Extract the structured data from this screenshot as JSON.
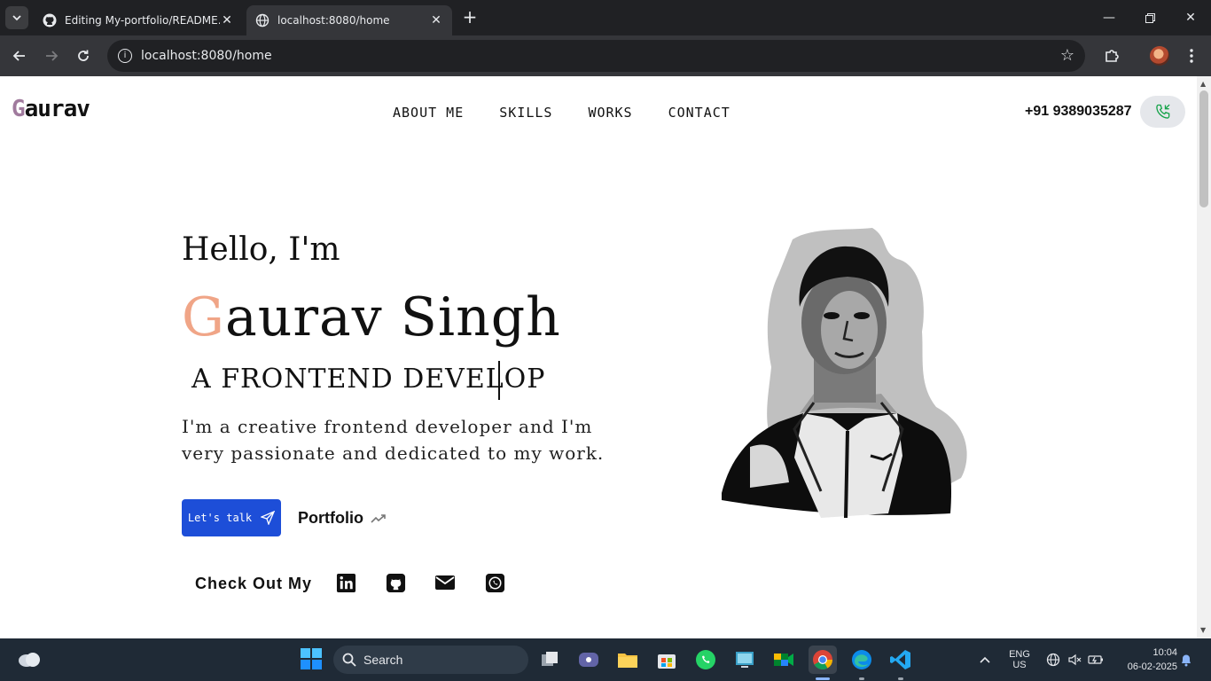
{
  "browser": {
    "tabs": [
      {
        "title": "Editing My-portfolio/README.md",
        "active": false
      },
      {
        "title": "localhost:8080/home",
        "active": true
      }
    ],
    "url": "localhost:8080/home"
  },
  "site": {
    "logo": {
      "first": "G",
      "rest": "aurav"
    },
    "nav": [
      "ABOUT ME",
      "SKILLS",
      "WORKS",
      "CONTACT"
    ],
    "phone": "+91 9389035287"
  },
  "hero": {
    "greeting": "Hello, I'm",
    "name_first": "G",
    "name_rest": "aurav Singh",
    "role": "A FRONTEND DEVELOP",
    "description": "I'm a creative frontend developer and I'm very passionate and dedicated to my work.",
    "talk_button": "Let's talk",
    "portfolio_link": "Portfolio",
    "checkout_label": "Check Out My",
    "socials": [
      "linkedin-icon",
      "github-icon",
      "mail-icon",
      "whatsapp-icon"
    ]
  },
  "taskbar": {
    "search_placeholder": "Search",
    "language": "ENG",
    "region": "US",
    "time": "10:04",
    "date": "06-02-2025"
  },
  "colors": {
    "accent_blue": "#1d4ed8",
    "name_initial": "#f0a587",
    "logo_initial": "#a07a9d",
    "phone_icon": "#16a34a"
  }
}
